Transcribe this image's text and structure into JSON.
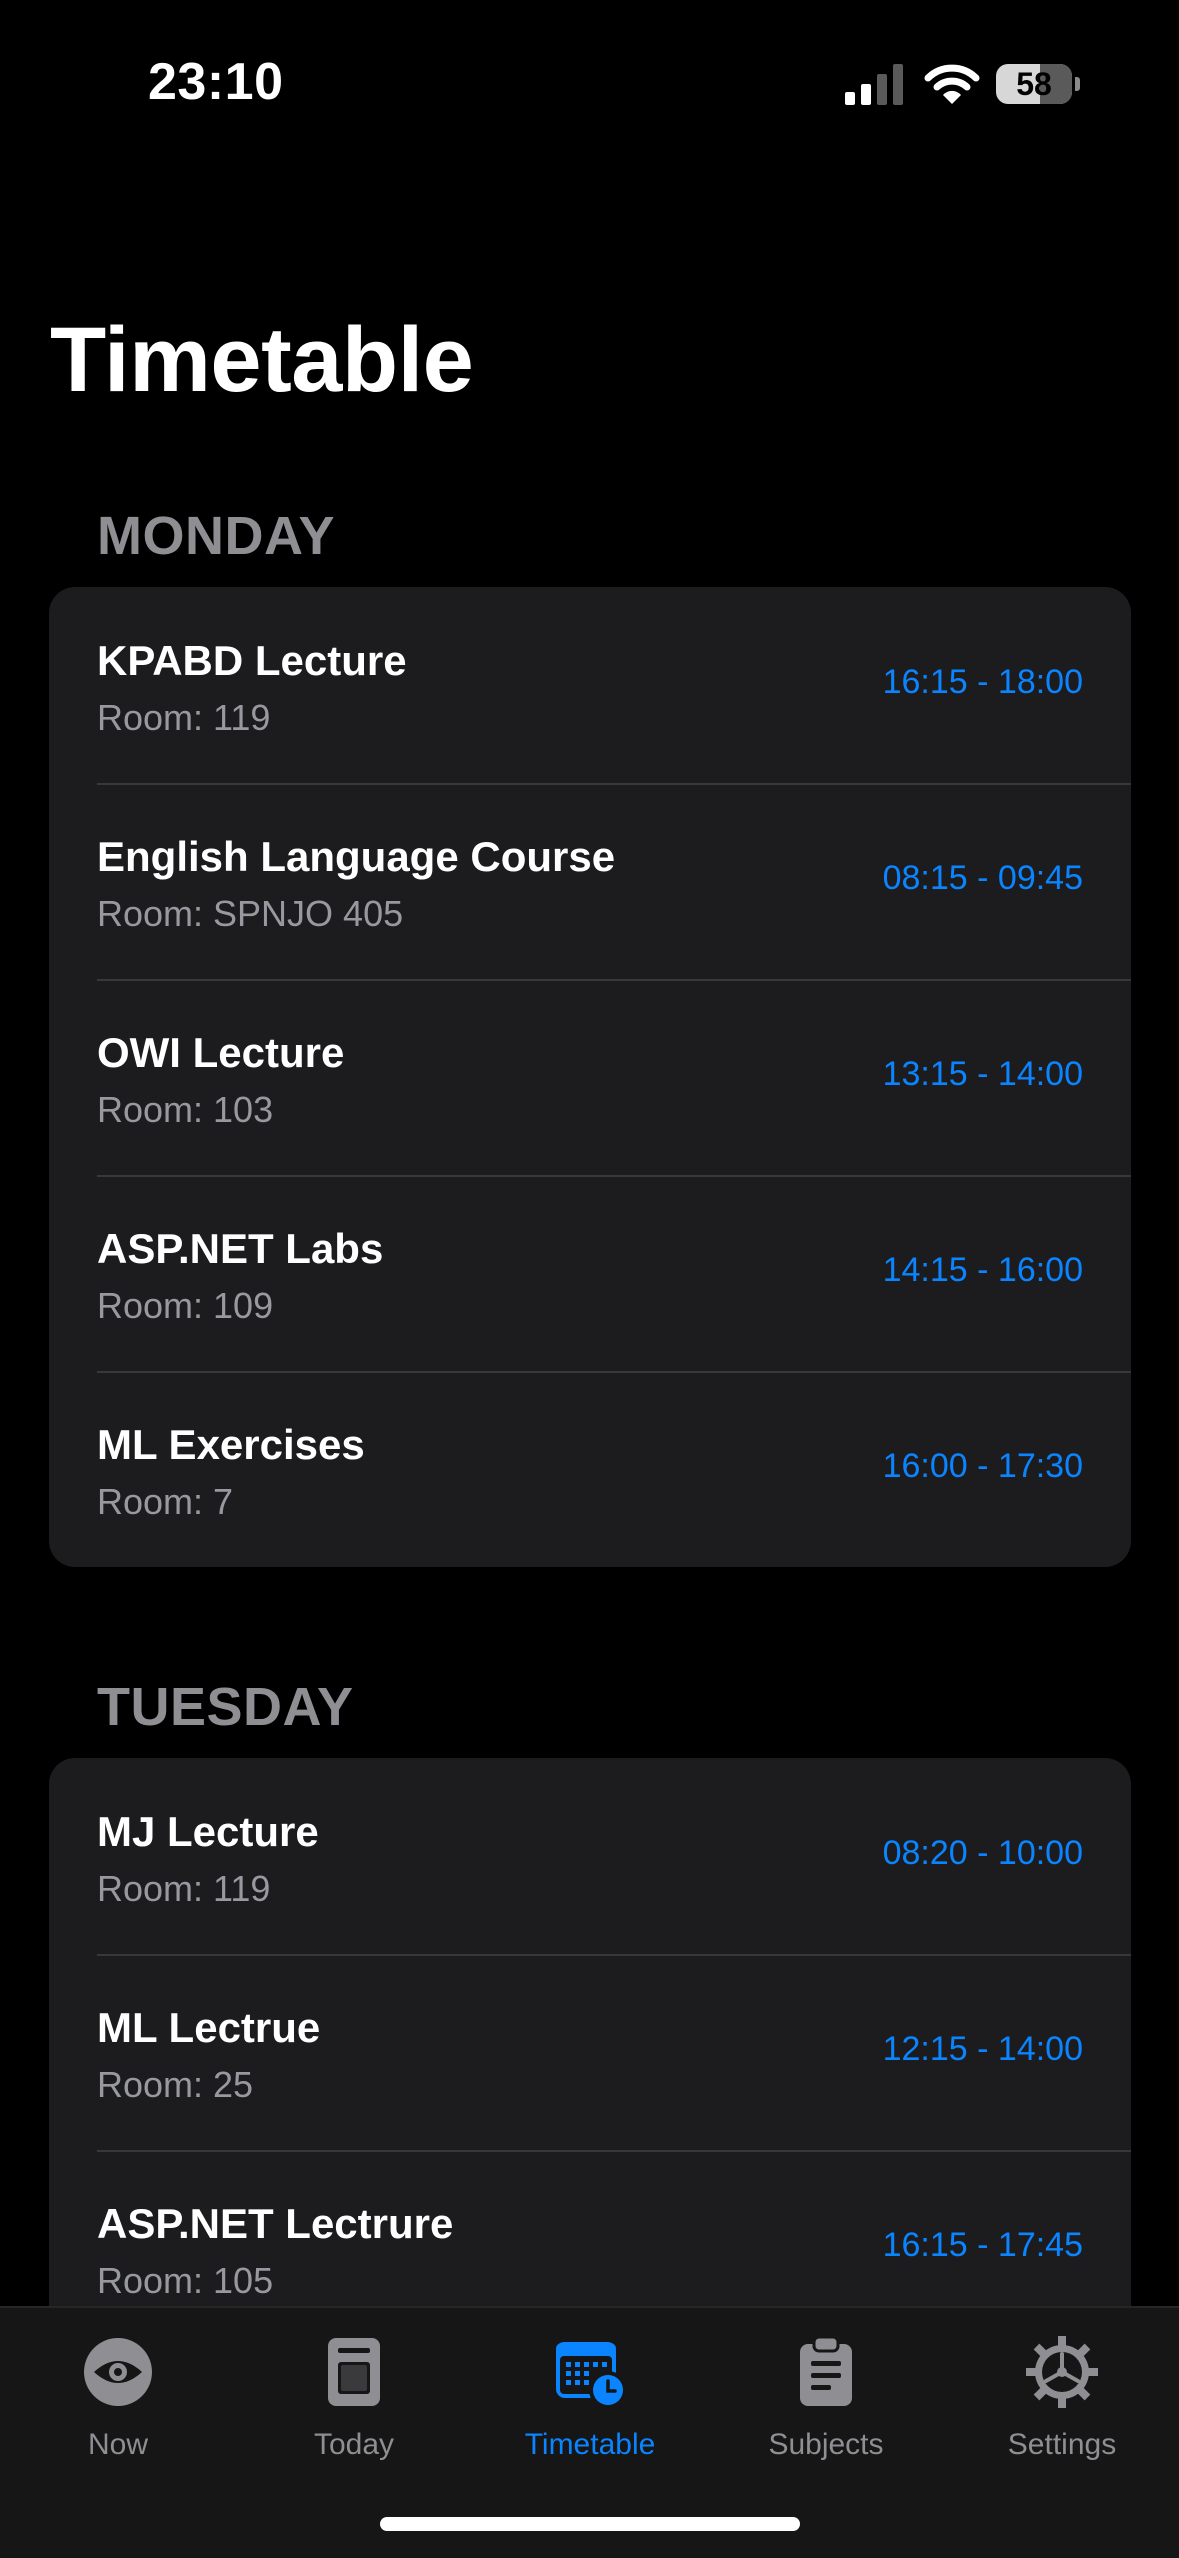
{
  "status_bar": {
    "time": "23:10",
    "battery_level": "58",
    "battery_fraction": 0.58
  },
  "page": {
    "title": "Timetable"
  },
  "sections": [
    {
      "day": "MONDAY",
      "entries": [
        {
          "title": "KPABD Lecture",
          "room": "Room: 119",
          "time": "16:15 - 18:00"
        },
        {
          "title": "English Language Course",
          "room": "Room: SPNJO 405",
          "time": "08:15 - 09:45"
        },
        {
          "title": "OWI Lecture",
          "room": "Room: 103",
          "time": "13:15 - 14:00"
        },
        {
          "title": "ASP.NET Labs",
          "room": "Room: 109",
          "time": "14:15 - 16:00"
        },
        {
          "title": "ML Exercises",
          "room": "Room: 7",
          "time": "16:00 - 17:30"
        }
      ]
    },
    {
      "day": "TUESDAY",
      "entries": [
        {
          "title": "MJ Lecture",
          "room": "Room: 119",
          "time": "08:20 - 10:00"
        },
        {
          "title": "ML Lectrue",
          "room": "Room: 25",
          "time": "12:15 - 14:00"
        },
        {
          "title": "ASP.NET Lectrure",
          "room": "Room: 105",
          "time": "16:15 - 17:45"
        }
      ]
    }
  ],
  "tab_bar": {
    "tabs": [
      {
        "label": "Now",
        "icon": "eye-icon",
        "active": false
      },
      {
        "label": "Today",
        "icon": "page-icon",
        "active": false
      },
      {
        "label": "Timetable",
        "icon": "calendar-clock-icon",
        "active": true
      },
      {
        "label": "Subjects",
        "icon": "clipboard-icon",
        "active": false
      },
      {
        "label": "Settings",
        "icon": "gear-icon",
        "active": false
      }
    ]
  },
  "colors": {
    "background": "#000000",
    "card": "#1c1c1e",
    "accent": "#0a84ff",
    "secondary_text": "#8e8e93"
  }
}
